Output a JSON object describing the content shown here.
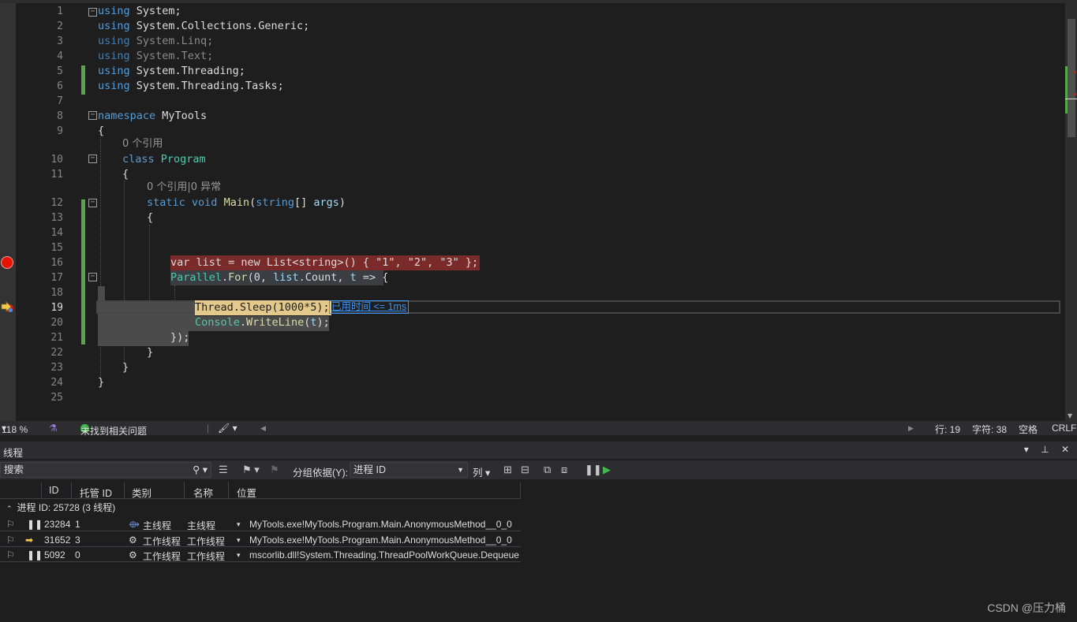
{
  "editor": {
    "line_numbers": [
      "1",
      "2",
      "3",
      "4",
      "5",
      "6",
      "7",
      "8",
      "9",
      "10",
      "11",
      "12",
      "13",
      "14",
      "15",
      "16",
      "17",
      "18",
      "19",
      "20",
      "21",
      "22",
      "23",
      "24",
      "25"
    ],
    "code": {
      "l1_kw": "using",
      "l1_rest": " System;",
      "l2_kw": "using",
      "l2_rest": " System.Collections.Generic;",
      "l3_kw": "using",
      "l3_rest": " System.Linq;",
      "l4_kw": "using",
      "l4_rest": " System.Text;",
      "l5_kw": "using",
      "l5_rest": " System.Threading;",
      "l6_kw": "using",
      "l6_rest": " System.Threading.Tasks;",
      "l8_kw": "namespace",
      "l8_rest": " MyTools",
      "l9": "{",
      "lens1": "0 个引用",
      "l10_kw": "class",
      "l10_ty": "Program",
      "l11": "{",
      "lens2": "0 个引用|0 异常",
      "l12_kw1": "static",
      "l12_kw2": "void",
      "l12_fn": "Main",
      "l12_p1": "(",
      "l12_kw3": "string",
      "l12_p2": "[] ",
      "l12_var": "args",
      "l12_p3": ")",
      "l13": "{",
      "l16": "var list = new List<string>() { \"1\", \"2\", \"3\" };",
      "l17_ty": "Parallel",
      "l17_dot": ".",
      "l17_fn": "For",
      "l17_p1": "(0, ",
      "l17_var": "list",
      "l17_p2": ".Count, ",
      "l17_var2": "t",
      "l17_p3": " => {",
      "l19": "Thread.Sleep(1000*5);",
      "l20_ty": "Console",
      "l20_dot": ".",
      "l20_fn": "WriteLine",
      "l20_p1": "(",
      "l20_var": "t",
      "l20_p2": ");",
      "l21": "});",
      "l22": "}",
      "l23": "}",
      "l24": "}"
    },
    "elapsed": "已用时间 <= 1ms"
  },
  "status": {
    "zoom": "118 %",
    "issues": "未找到相关问题",
    "line": "行: 19",
    "char": "字符: 38",
    "space": "空格",
    "eol": "CRLF"
  },
  "threads_panel": {
    "title": "线程",
    "search_placeholder": "搜索",
    "group_by_label": "分组依据(Y):",
    "group_by_value": "进程 ID",
    "columns_label": "列",
    "headers": [
      "ID",
      "托管 ID",
      "类别",
      "名称",
      "位置"
    ],
    "process_line": "进程 ID: 25728  (3 线程)",
    "rows": [
      {
        "id": "23284",
        "managed_id": "1",
        "category": "主线程",
        "name": "主线程",
        "location": "MyTools.exe!MyTools.Program.Main.AnonymousMethod__0_0"
      },
      {
        "id": "31652",
        "managed_id": "3",
        "category": "工作线程",
        "name": "工作线程",
        "location": "MyTools.exe!MyTools.Program.Main.AnonymousMethod__0_0"
      },
      {
        "id": "5092",
        "managed_id": "0",
        "category": "工作线程",
        "name": "工作线程",
        "location": "mscorlib.dll!System.Threading.ThreadPoolWorkQueue.Dequeue"
      }
    ]
  },
  "watermark": "CSDN @压力桶",
  "colors": {
    "breakpoint": "#e51400",
    "current_statement": "#e4c98c",
    "change_bar": "#57a64a",
    "link": "#3794ff"
  }
}
